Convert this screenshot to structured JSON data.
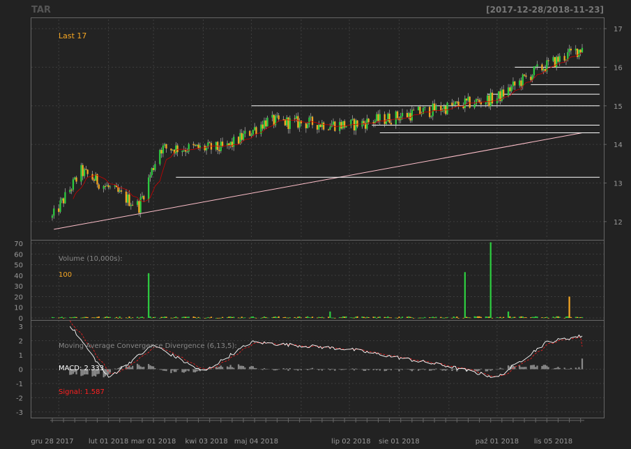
{
  "chart_title": "TAR",
  "date_range": "[2017-12-28/2018-11-23]",
  "colors": {
    "background": "#222222",
    "panel": "#232323",
    "border": "#666666",
    "grid": "#3e3e3e",
    "up": "#2ecc40",
    "down": "#f5a623",
    "text": "#999999",
    "last": "#f5a623",
    "trend": "#ffc0cb",
    "ma": "#cc0000",
    "hline": "#ffffff",
    "macd": "#ffffff",
    "signal": "#ff2020",
    "hist": "#888888"
  },
  "chart_data": [
    {
      "type": "candlestick",
      "panel": "price",
      "label": "Last 17",
      "last_value": 17,
      "ylim": [
        11.6,
        17.2
      ],
      "y_ticks": [
        12,
        13,
        14,
        15,
        16,
        17
      ],
      "key_points": [
        {
          "date": "2017-12-28",
          "close": 12.1
        },
        {
          "date": "2018-01-15",
          "close": 13.3
        },
        {
          "date": "2018-02-20",
          "close": 12.4
        },
        {
          "date": "2018-03-05",
          "close": 13.9
        },
        {
          "date": "2018-04-15",
          "close": 13.9
        },
        {
          "date": "2018-05-10",
          "close": 14.6
        },
        {
          "date": "2018-07-02",
          "close": 14.5
        },
        {
          "date": "2018-08-10",
          "close": 14.8
        },
        {
          "date": "2018-10-01",
          "close": 15.2
        },
        {
          "date": "2018-10-25",
          "close": 15.9
        },
        {
          "date": "2018-11-23",
          "close": 16.5
        }
      ],
      "horizontal_levels": [
        {
          "value": 16.0,
          "from": "2018-10-12"
        },
        {
          "value": 15.55,
          "from": "2018-10-22"
        },
        {
          "value": 15.3,
          "from": "2018-09-25"
        },
        {
          "value": 15.0,
          "from": "2018-05-01"
        },
        {
          "value": 14.5,
          "from": "2018-07-15"
        },
        {
          "value": 14.3,
          "from": "2018-07-20"
        },
        {
          "value": 13.15,
          "from": "2018-03-15"
        }
      ],
      "trend_line": {
        "from": {
          "date": "2017-12-29",
          "value": 11.8
        },
        "to": {
          "date": "2018-11-23",
          "value": 14.3
        }
      }
    },
    {
      "type": "bar",
      "panel": "volume",
      "label": "Volume (10,000s):",
      "last_value": "100",
      "ylim": [
        0,
        72
      ],
      "y_ticks": [
        0,
        10,
        20,
        30,
        40,
        50,
        60,
        70
      ],
      "spikes": [
        {
          "date": "2018-02-27",
          "value": 42,
          "dir": "up"
        },
        {
          "date": "2018-06-20",
          "value": 6,
          "dir": "up"
        },
        {
          "date": "2018-09-12",
          "value": 43,
          "dir": "up"
        },
        {
          "date": "2018-09-28",
          "value": 71,
          "dir": "up"
        },
        {
          "date": "2018-10-08",
          "value": 6,
          "dir": "up"
        },
        {
          "date": "2018-11-16",
          "value": 20,
          "dir": "down"
        }
      ]
    },
    {
      "type": "line",
      "panel": "macd",
      "title": "Moving Average Convergence Divergence (6,13,5):",
      "macd_label": "MACD: 2.333",
      "signal_label": "Signal: 1.587",
      "ylim": [
        -3.3,
        3.3
      ],
      "y_ticks": [
        -3,
        -2,
        -1,
        0,
        1,
        2,
        3
      ],
      "macd_points": [
        {
          "date": "2018-01-08",
          "value": 3.1
        },
        {
          "date": "2018-02-01",
          "value": -0.6
        },
        {
          "date": "2018-03-01",
          "value": 1.7
        },
        {
          "date": "2018-04-01",
          "value": -0.2
        },
        {
          "date": "2018-05-01",
          "value": 1.9
        },
        {
          "date": "2018-07-01",
          "value": 1.4
        },
        {
          "date": "2018-09-01",
          "value": 0.2
        },
        {
          "date": "2018-10-01",
          "value": -0.6
        },
        {
          "date": "2018-11-01",
          "value": 1.9
        },
        {
          "date": "2018-11-23",
          "value": 2.333
        }
      ],
      "signal_last": 1.587
    }
  ],
  "x_axis": {
    "ticks": [
      "gru 28 2017",
      "lut 01 2018",
      "mar 01 2018",
      "kwi 03 2018",
      "maj 04 2018",
      "lip 02 2018",
      "sie 01 2018",
      "paź 01 2018",
      "lis 05 2018"
    ]
  }
}
